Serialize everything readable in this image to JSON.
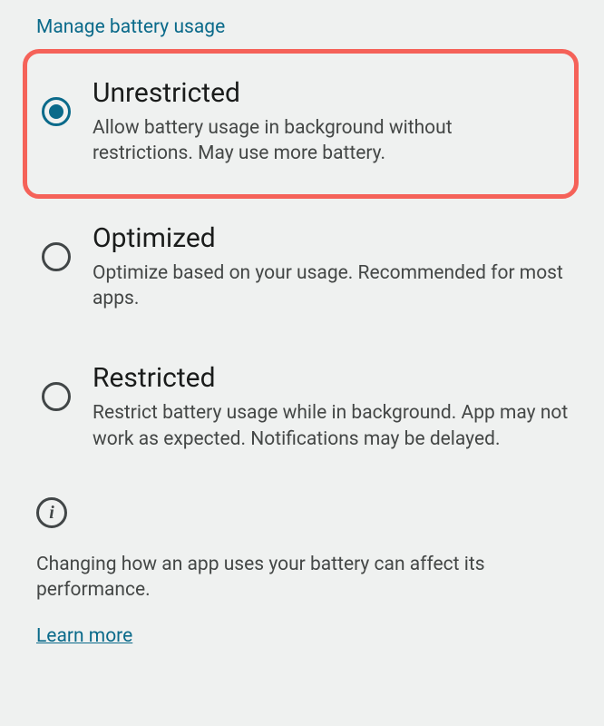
{
  "header": {
    "title": "Manage battery usage"
  },
  "options": [
    {
      "title": "Unrestricted",
      "description": "Allow battery usage in background without restrictions. May use more battery.",
      "selected": true,
      "highlighted": true
    },
    {
      "title": "Optimized",
      "description": "Optimize based on your usage. Recommended for most apps.",
      "selected": false,
      "highlighted": false
    },
    {
      "title": "Restricted",
      "description": "Restrict battery usage while in background. App may not work as expected. Notifications may be delayed.",
      "selected": false,
      "highlighted": false
    }
  ],
  "info": {
    "text": "Changing how an app uses your battery can affect its performance.",
    "learn_more": "Learn more"
  }
}
